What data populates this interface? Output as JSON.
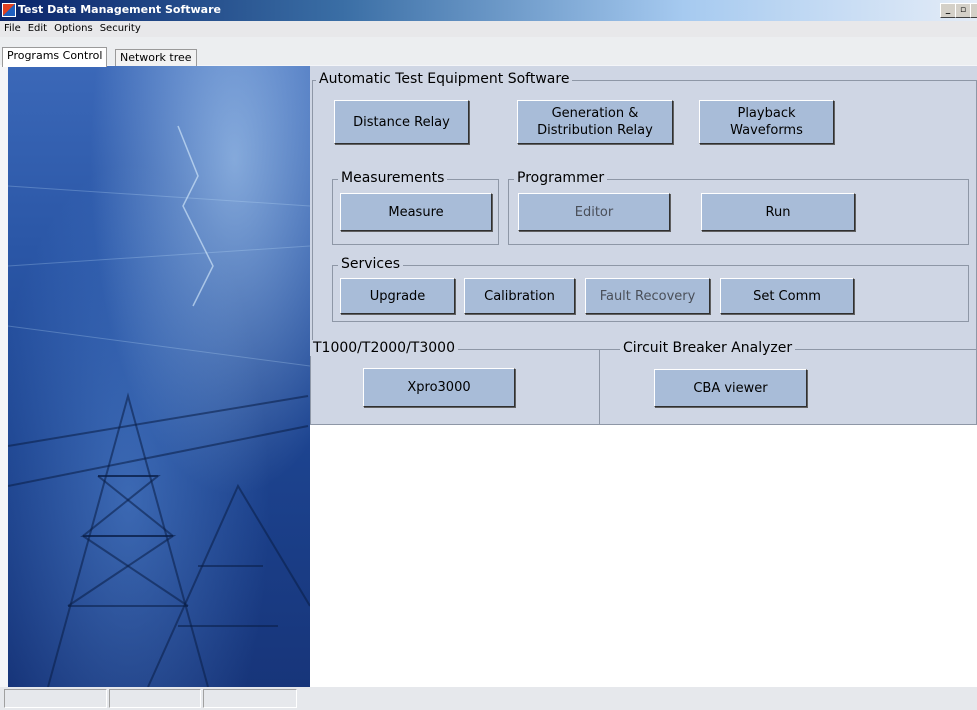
{
  "window": {
    "title": "Test Data Management Software"
  },
  "menu": [
    "File",
    "Edit",
    "Options",
    "Security"
  ],
  "tabs": [
    "Programs Control",
    "Network tree"
  ],
  "ate": {
    "legend": "Automatic Test Equipment Software",
    "distance_relay": "Distance Relay",
    "generation_line1": "Generation &",
    "generation_line2": "Distribution Relay",
    "playback_line1": "Playback",
    "playback_line2": "Waveforms"
  },
  "measurements": {
    "legend": "Measurements",
    "measure": "Measure"
  },
  "programmer": {
    "legend": "Programmer",
    "editor": "Editor",
    "run": "Run"
  },
  "services": {
    "legend": "Services",
    "upgrade": "Upgrade",
    "calibration": "Calibration",
    "fault_recovery": "Fault Recovery",
    "set_comm": "Set Comm"
  },
  "t_series": {
    "legend": "T1000/T2000/T3000",
    "xpro": "Xpro3000"
  },
  "cba": {
    "legend": "Circuit Breaker Analyzer",
    "viewer": "CBA viewer"
  },
  "colors": {
    "panel": "#cfd6e4",
    "button": "#a8bcd8",
    "titlebar": "#0a246a"
  }
}
